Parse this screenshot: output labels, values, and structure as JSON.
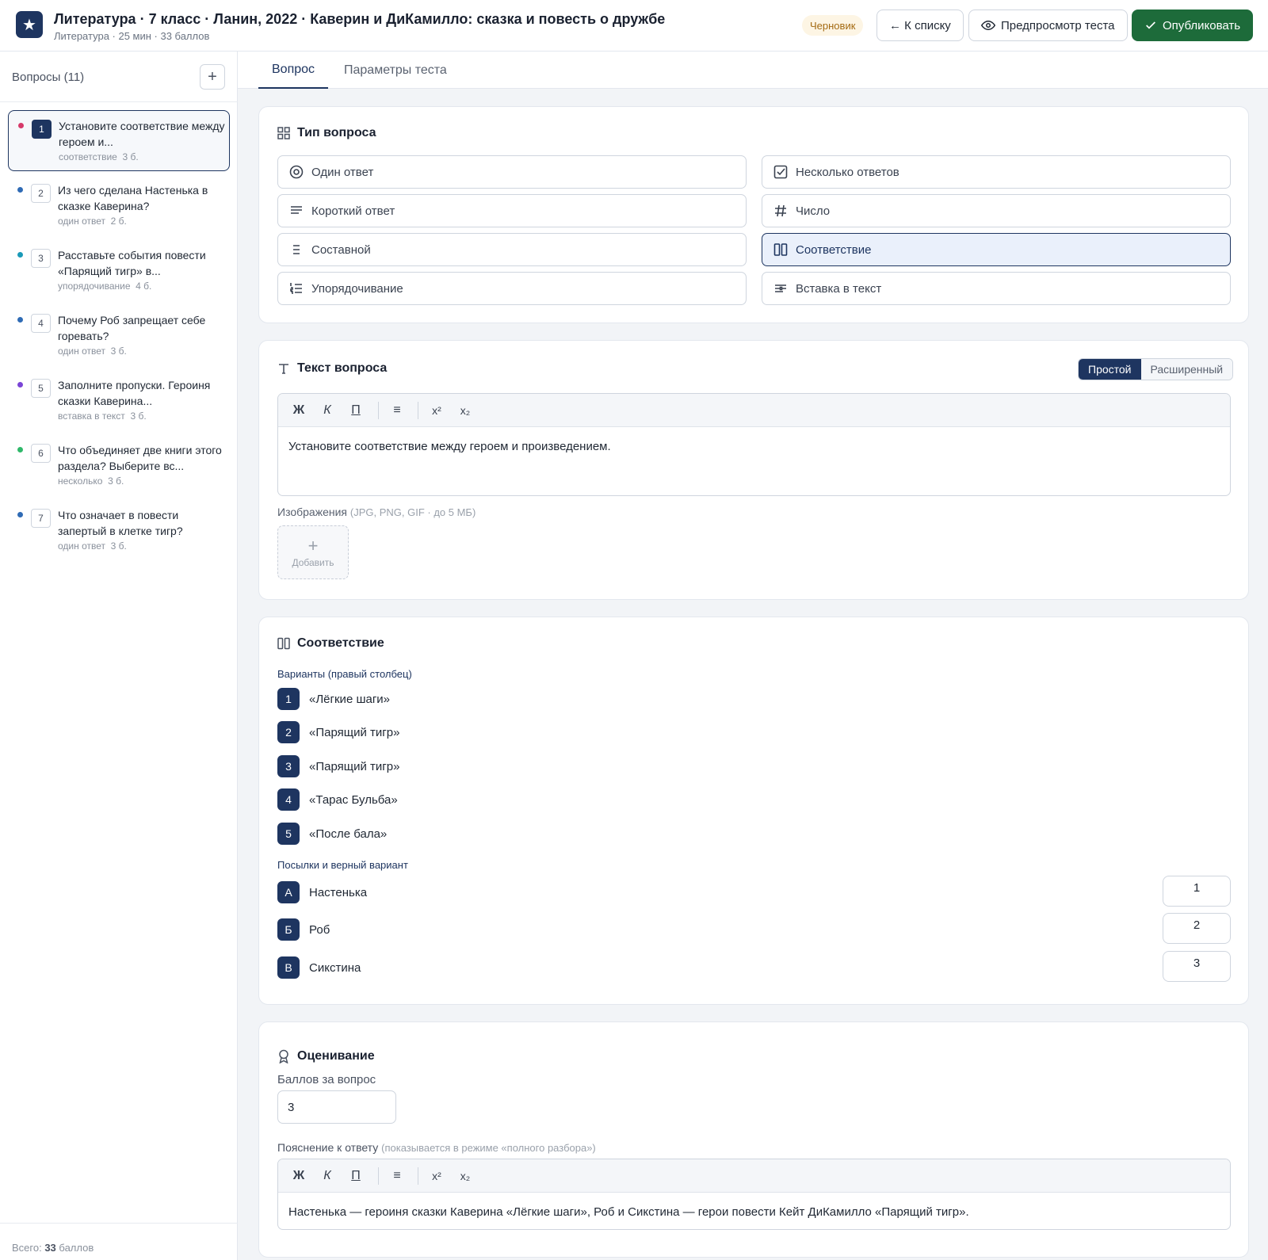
{
  "header": {
    "logo_glyph": "★",
    "title": "Литература · 7 класс · Ланин, 2022 · Каверин и ДиКамилло: сказка и повесть о дружбе",
    "subtitle": "Литература · 25 мин · 33 баллов",
    "status_badge": "Черновик",
    "back_label": "← К списку",
    "preview_label": "Предпросмотр теста",
    "publish_label": "Опубликовать",
    "publish_color": "#1d6b3a",
    "accent_color": "#1e3560"
  },
  "sidebar": {
    "heading": "Вопросы (11)",
    "add_glyph": "+",
    "items": [
      {
        "num": "1",
        "text": "Установите соответствие между героем и...",
        "type": "соответствие",
        "points": "3 б.",
        "dot": "#d63a6a",
        "active": true
      },
      {
        "num": "2",
        "text": "Из чего сделана Настенька в сказке Каверина?",
        "type": "один ответ",
        "points": "2 б.",
        "dot": "#2f6bb5"
      },
      {
        "num": "3",
        "text": "Расставьте события повести «Парящий тигр» в...",
        "type": "упорядочивание",
        "points": "4 б.",
        "dot": "#1a9ab8"
      },
      {
        "num": "4",
        "text": "Почему Роб запрещает себе горевать?",
        "type": "один ответ",
        "points": "3 б.",
        "dot": "#2f6bb5"
      },
      {
        "num": "5",
        "text": "Заполните пропуски. Героиня сказки Каверина...",
        "type": "вставка в текст",
        "points": "3 б.",
        "dot": "#7a45d6"
      },
      {
        "num": "6",
        "text": "Что объединяет две книги этого раздела? Выберите вс...",
        "type": "несколько",
        "points": "3 б.",
        "dot": "#2fb86a"
      },
      {
        "num": "7",
        "text": "Что означает в повести запертый в клетке тигр?",
        "type": "один ответ",
        "points": "3 б.",
        "dot": "#2f6bb5"
      }
    ],
    "footer_prefix": "Всего:",
    "footer_value": "33",
    "footer_suffix": "баллов"
  },
  "tabs": [
    "Вопрос",
    "Параметры теста"
  ],
  "question_type": {
    "title": "Тип вопроса",
    "options": [
      {
        "label": "Один ответ",
        "icon": "radio-icon"
      },
      {
        "label": "Несколько ответов",
        "icon": "checkbox-icon"
      },
      {
        "label": "Короткий ответ",
        "icon": "short-text-icon"
      },
      {
        "label": "Число",
        "icon": "hash-icon"
      },
      {
        "label": "Составной",
        "icon": "list-icon"
      },
      {
        "label": "Соответствие",
        "icon": "columns-icon",
        "selected": true
      },
      {
        "label": "Упорядочивание",
        "icon": "ordered-list-icon"
      },
      {
        "label": "Вставка в текст",
        "icon": "text-insert-icon"
      }
    ]
  },
  "question_text": {
    "title": "Текст вопроса",
    "mode_simple": "Простой",
    "mode_advanced": "Расширенный",
    "toolbar": {
      "bold": "Ж",
      "italic": "К",
      "underline": "П",
      "list": "≡",
      "sup": "x²",
      "sub": "x₂"
    },
    "content": "Установите соответствие между героем и произведением.",
    "images_label": "Изображения",
    "images_hint": "(JPG, PNG, GIF · до 5 МБ)",
    "add_image_plus": "+",
    "add_image_label": "Добавить"
  },
  "matching": {
    "title": "Соответствие",
    "options_label": "Варианты (правый столбец)",
    "options": [
      {
        "num": "1",
        "text": "«Лёгкие шаги»"
      },
      {
        "num": "2",
        "text": "«Парящий тигр»"
      },
      {
        "num": "3",
        "text": "«Парящий тигр»"
      },
      {
        "num": "4",
        "text": "«Тарас Бульба»"
      },
      {
        "num": "5",
        "text": "«После бала»"
      }
    ],
    "premises_label": "Посылки и верный вариант",
    "premises": [
      {
        "letter": "А",
        "text": "Настенька",
        "answer": "1"
      },
      {
        "letter": "Б",
        "text": "Роб",
        "answer": "2"
      },
      {
        "letter": "В",
        "text": "Сикстина",
        "answer": "3"
      }
    ]
  },
  "scoring": {
    "title": "Оценивание",
    "points_label": "Баллов за вопрос",
    "points_value": "3",
    "explanation_label": "Пояснение к ответу",
    "explanation_hint": "(показывается в режиме «полного разбора»)",
    "explanation_text": "Настенька — героиня сказки Каверина «Лёгкие шаги», Роб и Сикстина — герои повести Кейт ДиКамилло «Парящий тигр»."
  }
}
